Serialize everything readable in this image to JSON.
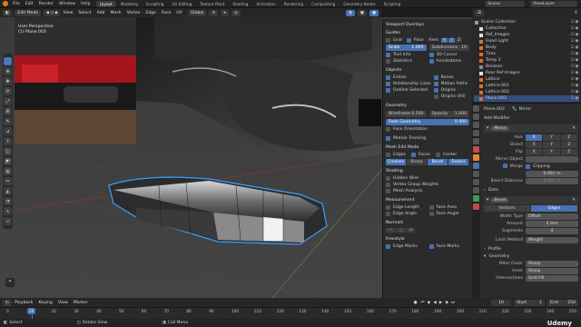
{
  "menu": {
    "items": [
      "File",
      "Edit",
      "Render",
      "Window",
      "Help"
    ],
    "workspaces": [
      {
        "label": "Layout",
        "active": true
      },
      {
        "label": "Modeling",
        "active": false
      },
      {
        "label": "Sculpting",
        "active": false
      },
      {
        "label": "UV Editing",
        "active": false
      },
      {
        "label": "Texture Paint",
        "active": false
      },
      {
        "label": "Shading",
        "active": false
      },
      {
        "label": "Animation",
        "active": false
      },
      {
        "label": "Rendering",
        "active": false
      },
      {
        "label": "Compositing",
        "active": false
      },
      {
        "label": "Geometry Nodes",
        "active": false
      },
      {
        "label": "Scripting",
        "active": false
      }
    ],
    "scene": "Scene",
    "view_layer": "ViewLayer"
  },
  "viewport_header": {
    "mode": "Edit Mode",
    "menus": [
      "View",
      "Select",
      "Add",
      "Mesh",
      "Vertex",
      "Edge",
      "Face",
      "UV"
    ],
    "orientation": "Global"
  },
  "viewport": {
    "perspective": "User Perspective",
    "object_label": "(1) Plane.003"
  },
  "overlays": {
    "title": "Viewport Overlays",
    "guides_title": "Guides",
    "grid": "Grid",
    "floor": "Floor",
    "axes": "Axes",
    "axes_values": [
      "X",
      "Y",
      "Z"
    ],
    "scale_label": "Scale",
    "scale_value": "1.000",
    "subdivisions_label": "Subdivisions",
    "subdivisions_value": "10",
    "text_info": "Text Info",
    "cursor_3d": "3D Cursor",
    "statistics": "Statistics",
    "annotations": "Annotations",
    "objects_title": "Objects",
    "extras": "Extras",
    "bones": "Bones",
    "relationship_lines": "Relationship Lines",
    "motion_paths": "Motion Paths",
    "outline_selected": "Outline Selected",
    "origins": "Origins",
    "origins_all": "Origins (All)",
    "geometry_title": "Geometry",
    "wireframe": "Wireframe",
    "wireframe_value": "0.500",
    "opacity": "Opacity",
    "opacity_value": "1.000",
    "fade_geometry": "Fade Geometry",
    "fade_value": "0.400",
    "face_orientation": "Face Orientation",
    "motion_tracking": "Motion Tracking",
    "mesh_edit_title": "Mesh Edit Mode",
    "edges": "Edges",
    "faces": "Faces",
    "center": "Center",
    "creases": "Creases",
    "sharp": "Sharp",
    "bevel": "Bevel",
    "seams": "Seams",
    "shading_title": "Shading",
    "hidden_wire": "Hidden Wire",
    "vertex_group_weights": "Vertex Group Weights",
    "mesh_analysis": "Mesh Analysis",
    "measurement_title": "Measurement",
    "edge_length": "Edge Length",
    "face_area": "Face Area",
    "edge_angle": "Edge Angle",
    "face_angle": "Face Angle",
    "normals_title": "Normals",
    "freestyle_title": "Freestyle",
    "edge_marks": "Edge Marks",
    "face_marks": "Face Marks"
  },
  "outliner": {
    "title": "Scene Collection",
    "items": [
      {
        "name": "Scene Collection",
        "color": "#9a9a9a",
        "selected": false
      },
      {
        "name": "Collection",
        "color": "#e0e0e0",
        "selected": false
      },
      {
        "name": "Ref_Images",
        "color": "#e0e0e0",
        "selected": false
      },
      {
        "name": "Head Light",
        "color": "#e06c2c",
        "selected": false
      },
      {
        "name": "Body",
        "color": "#e06c2c",
        "selected": false
      },
      {
        "name": "Tires",
        "color": "#e06c2c",
        "selected": false
      },
      {
        "name": "Temp 2",
        "color": "#e06c2c",
        "selected": false
      },
      {
        "name": "Boolean",
        "color": "#8c8c8c",
        "selected": false
      },
      {
        "name": "Rear Ref Images",
        "color": "#e0e0e0",
        "selected": false
      },
      {
        "name": "Lattice",
        "color": "#e06c2c",
        "selected": false
      },
      {
        "name": "Lattice.001",
        "color": "#e06c2c",
        "selected": false
      },
      {
        "name": "Lattice.002",
        "color": "#e06c2c",
        "selected": false
      },
      {
        "name": "Plane.003",
        "color": "#e06c2c",
        "selected": true
      }
    ]
  },
  "properties": {
    "object_name": "Plane.003",
    "modifier_tab": "Mirror",
    "add_modifier": "Add Modifier",
    "mirror": {
      "name": "Mirror",
      "axis_label": "Axis",
      "bisect_label": "Bisect",
      "flip_label": "Flip",
      "axes": [
        "X",
        "Y",
        "Z"
      ],
      "mirror_object_label": "Mirror Object",
      "merge_label": "Merge",
      "merge_value": "0.001 m",
      "clipping_label": "Clipping",
      "bisect_distance_label": "Bisect Distance",
      "bisect_distance_value": "0.001 m",
      "data_label": "Data"
    },
    "bevel": {
      "name": "Bevel",
      "vertices": "Vertices",
      "edges": "Edges",
      "width_type_label": "Width Type",
      "width_type_value": "Offset",
      "amount_label": "Amount",
      "amount_value": "3 mm",
      "segments_label": "Segments",
      "segments_value": "4",
      "limit_method_label": "Limit Method",
      "limit_method_value": "Weight",
      "profile_label": "Profile",
      "geometry_label": "Geometry",
      "miter_outer_label": "Miter Outer",
      "miter_outer_value": "Sharp",
      "inner_label": "Inner",
      "inner_value": "Sharp",
      "intersections_label": "Intersections",
      "intersections_value": "Grid Fill"
    }
  },
  "timeline": {
    "menus": [
      "Playback",
      "Keying",
      "View",
      "Marker"
    ],
    "current_frame": "10",
    "start_label": "Start",
    "start_value": "1",
    "end_label": "End",
    "end_value": "250",
    "frames": [
      "0",
      "10",
      "20",
      "30",
      "40",
      "50",
      "60",
      "70",
      "80",
      "90",
      "100",
      "110",
      "120",
      "130",
      "140",
      "150",
      "160",
      "170",
      "180",
      "190",
      "200",
      "210",
      "220",
      "230",
      "240",
      "250"
    ]
  },
  "statusbar": {
    "select": "Select",
    "rotate_view": "Rotate View",
    "call_menu": "Call Menu",
    "watermark": "Udemy"
  },
  "colors": {
    "accent": "#4772b3",
    "selection_outline": "#3aa0ff",
    "active_frame": "#4772b3"
  }
}
